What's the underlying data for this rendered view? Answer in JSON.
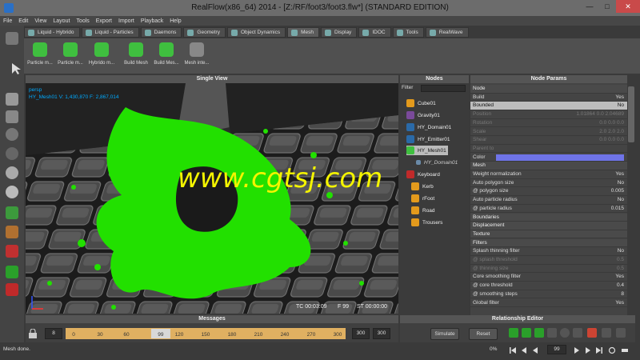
{
  "window": {
    "title": "RealFlow(x86_64) 2014 - [Z:/RF/foot3/foot3.flw*] (STANDARD EDITION)"
  },
  "menu": [
    "File",
    "Edit",
    "View",
    "Layout",
    "Tools",
    "Export",
    "Import",
    "Playback",
    "Help"
  ],
  "tabs": [
    "Liquid - Hybrido",
    "Liquid - Particles",
    "Daemons",
    "Geometry",
    "Object Dynamics",
    "Mesh",
    "Display",
    "IDOC",
    "Tools",
    "RealWave"
  ],
  "active_tab": "Mesh",
  "shelf": [
    "Particle m...",
    "Particle m...",
    "Hybrido m...",
    "Build Mesh",
    "Build Mes...",
    "Mesh inte..."
  ],
  "viewport": {
    "title": "Single View",
    "overlay_line1": "persp",
    "overlay_line2": "HY_Mesh01  V: 1,430,870  F: 2,867,014",
    "watermark": "www.cgtsj.com",
    "tc": "TC 00:03:09",
    "frame": "F 99",
    "st": "ST 00:00:00"
  },
  "nodes": {
    "title": "Nodes",
    "filter_label": "Filter",
    "items": [
      "Cube01",
      "Gravity01",
      "HY_Domain01",
      "HY_Emitter01",
      "HY_Mesh01",
      "HY_Domain01",
      "Keyboard",
      "Kerb",
      "rFoot",
      "Road",
      "Trousers"
    ]
  },
  "params": {
    "title": "Node Params",
    "rows": [
      {
        "k": "Node",
        "v": "",
        "type": "sec"
      },
      {
        "k": "Build",
        "v": "Yes",
        "type": ""
      },
      {
        "k": "Bounded",
        "v": "No",
        "type": "hl"
      },
      {
        "k": "Position",
        "v": "1.01864   0.0   2.04689",
        "type": "dim"
      },
      {
        "k": "Rotation",
        "v": "0.0   0.0   0.0",
        "type": "dim"
      },
      {
        "k": "Scale",
        "v": "2.0   2.0   2.0",
        "type": "dim"
      },
      {
        "k": "Shear",
        "v": "0.0   0.0   0.0",
        "type": "dim"
      },
      {
        "k": "Parent to",
        "v": "",
        "type": "dim"
      },
      {
        "k": "Color",
        "v": "",
        "type": "color"
      },
      {
        "k": "Mesh",
        "v": "",
        "type": "sec"
      },
      {
        "k": "Weight normalization",
        "v": "Yes",
        "type": ""
      },
      {
        "k": "Auto polygon size",
        "v": "No",
        "type": ""
      },
      {
        "k": "@ polygon size",
        "v": "0.005",
        "type": ""
      },
      {
        "k": "Auto particle radius",
        "v": "No",
        "type": ""
      },
      {
        "k": "@ particle radius",
        "v": "0.015",
        "type": ""
      },
      {
        "k": "Boundaries",
        "v": "",
        "type": "sec"
      },
      {
        "k": "Displacement",
        "v": "",
        "type": "sec"
      },
      {
        "k": "Texture",
        "v": "",
        "type": "sec"
      },
      {
        "k": "Filters",
        "v": "",
        "type": "sec"
      },
      {
        "k": "Splash thinning filter",
        "v": "No",
        "type": ""
      },
      {
        "k": "@ splash threshold",
        "v": "0.5",
        "type": "dim"
      },
      {
        "k": "@ thinning size",
        "v": "0.5",
        "type": "dim"
      },
      {
        "k": "Core smoothing filter",
        "v": "Yes",
        "type": ""
      },
      {
        "k": "@ core threshold",
        "v": "0.4",
        "type": ""
      },
      {
        "k": "@ smoothing steps",
        "v": "8",
        "type": ""
      },
      {
        "k": "Global filter",
        "v": "Yes",
        "type": ""
      }
    ],
    "color_value": "#6f74e8"
  },
  "messages": {
    "title": "Messages",
    "status": "Mesh done."
  },
  "relationship": {
    "title": "Relationship Editor"
  },
  "timeline": {
    "start_field": "8",
    "ticks": [
      "0",
      "30",
      "60",
      "99",
      "120",
      "150",
      "180",
      "210",
      "240",
      "270",
      "300"
    ],
    "current": "99",
    "end1": "300",
    "end2": "300"
  },
  "controls": {
    "simulate": "Simulate",
    "reset": "Reset",
    "progress": "0%",
    "frame_field": "99"
  },
  "accent": {
    "liquid": "#22e000",
    "timeline": "#e0b061",
    "watermark": "#f4f400"
  }
}
